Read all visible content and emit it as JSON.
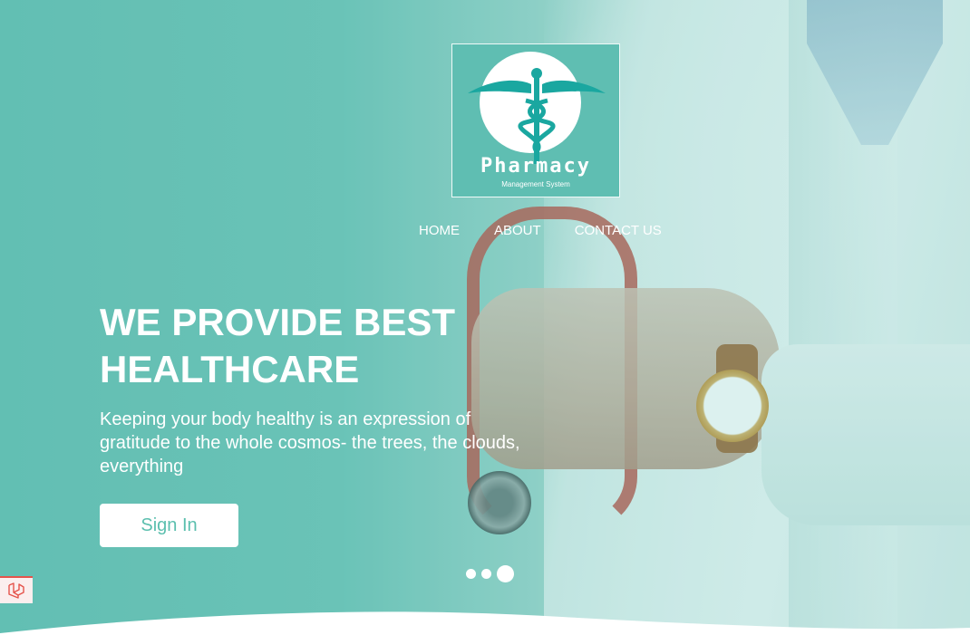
{
  "logo": {
    "title": "Pharmacy",
    "subtitle": "Management System",
    "icon": "caduceus-icon"
  },
  "nav": {
    "items": [
      {
        "label": "HOME"
      },
      {
        "label": "ABOUT"
      },
      {
        "label": "CONTACT US"
      }
    ]
  },
  "hero": {
    "headline": "WE PROVIDE BEST HEALTHCARE",
    "tagline": "Keeping your body healthy is an expression of gratitude to the whole cosmos- the trees, the clouds, everything",
    "cta_label": "Sign In",
    "slides_total": 3,
    "active_slide": 3
  },
  "debug_badge": {
    "icon": "laravel-icon"
  },
  "colors": {
    "accent": "#5bbfae",
    "logo_bg": "#5fbeb2",
    "caduceus": "#1aa7a0"
  }
}
